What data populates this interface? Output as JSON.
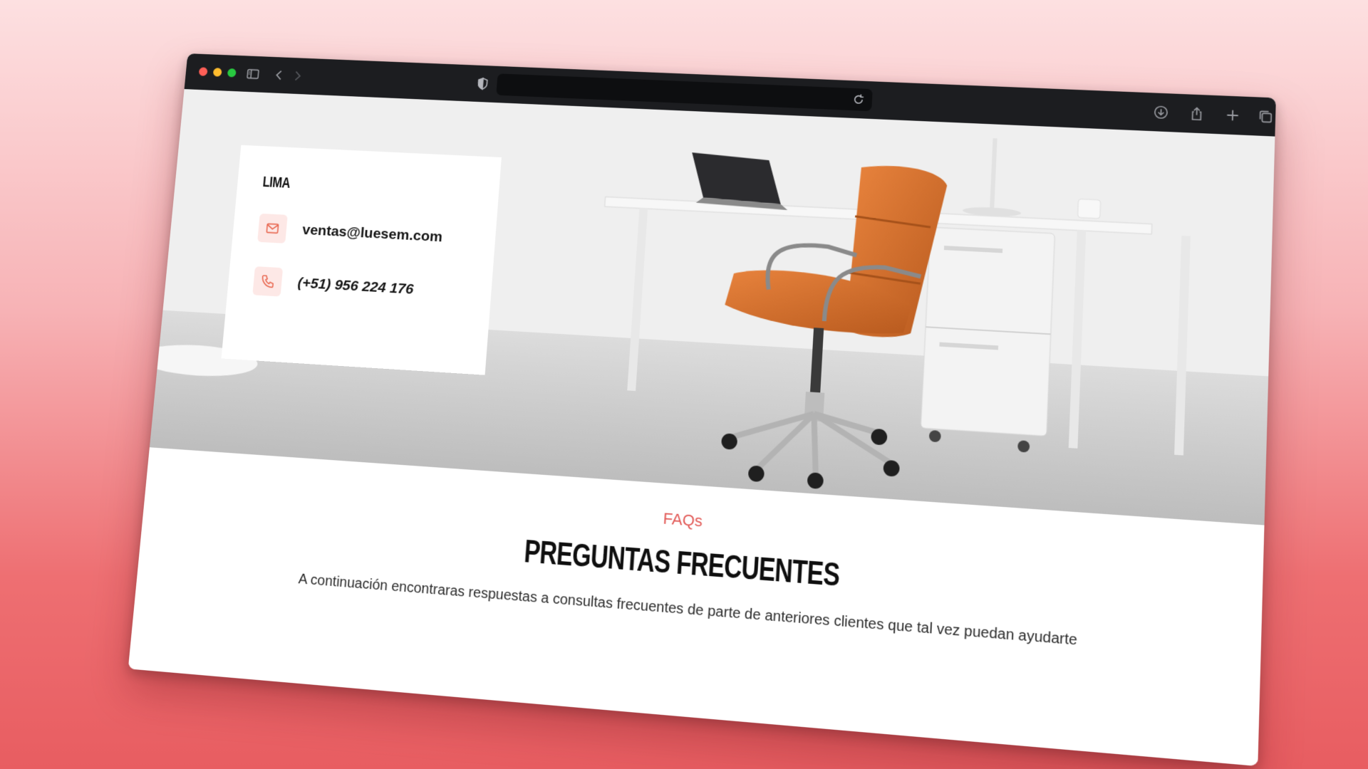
{
  "browser": {
    "traffic_lights": [
      "#ff5f57",
      "#febc2e",
      "#28c840"
    ],
    "icons": [
      "sidebar-icon",
      "back-icon",
      "forward-icon",
      "shield-icon",
      "reload-icon",
      "download-icon",
      "share-icon",
      "new-tab-icon",
      "tabs-overview-icon"
    ],
    "url": ""
  },
  "contact": {
    "city": "LIMA",
    "email": "ventas@luesem.com",
    "phone": "(+51) 956 224 176",
    "accent_color": "#e8664f"
  },
  "faq": {
    "eyebrow": "FAQs",
    "title": "PREGUNTAS FRECUENTES",
    "description": "A continuación encontraras respuestas a consultas frecuentes de parte de anteriores clientes que tal vez puedan ayudarte"
  }
}
